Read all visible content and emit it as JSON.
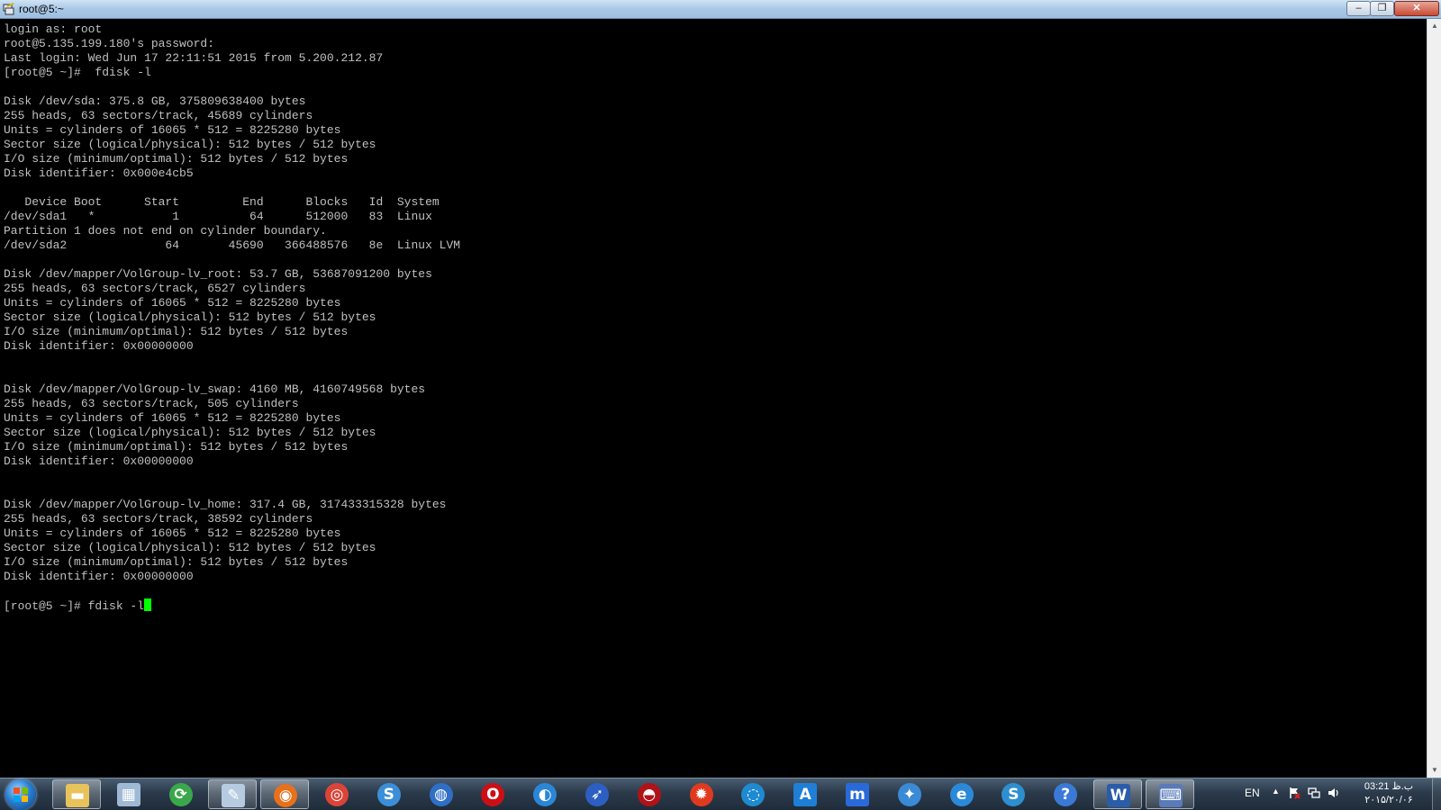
{
  "window": {
    "title": "root@5:~",
    "min_label": "–",
    "max_label": "❐",
    "close_label": "✕"
  },
  "terminal": {
    "lines": [
      "login as: root",
      "root@5.135.199.180's password:",
      "Last login: Wed Jun 17 22:11:51 2015 from 5.200.212.87",
      "[root@5 ~]#  fdisk -l",
      "",
      "Disk /dev/sda: 375.8 GB, 375809638400 bytes",
      "255 heads, 63 sectors/track, 45689 cylinders",
      "Units = cylinders of 16065 * 512 = 8225280 bytes",
      "Sector size (logical/physical): 512 bytes / 512 bytes",
      "I/O size (minimum/optimal): 512 bytes / 512 bytes",
      "Disk identifier: 0x000e4cb5",
      "",
      "   Device Boot      Start         End      Blocks   Id  System",
      "/dev/sda1   *           1          64      512000   83  Linux",
      "Partition 1 does not end on cylinder boundary.",
      "/dev/sda2              64       45690   366488576   8e  Linux LVM",
      "",
      "Disk /dev/mapper/VolGroup-lv_root: 53.7 GB, 53687091200 bytes",
      "255 heads, 63 sectors/track, 6527 cylinders",
      "Units = cylinders of 16065 * 512 = 8225280 bytes",
      "Sector size (logical/physical): 512 bytes / 512 bytes",
      "I/O size (minimum/optimal): 512 bytes / 512 bytes",
      "Disk identifier: 0x00000000",
      "",
      "",
      "Disk /dev/mapper/VolGroup-lv_swap: 4160 MB, 4160749568 bytes",
      "255 heads, 63 sectors/track, 505 cylinders",
      "Units = cylinders of 16065 * 512 = 8225280 bytes",
      "Sector size (logical/physical): 512 bytes / 512 bytes",
      "I/O size (minimum/optimal): 512 bytes / 512 bytes",
      "Disk identifier: 0x00000000",
      "",
      "",
      "Disk /dev/mapper/VolGroup-lv_home: 317.4 GB, 317433315328 bytes",
      "255 heads, 63 sectors/track, 38592 cylinders",
      "Units = cylinders of 16065 * 512 = 8225280 bytes",
      "Sector size (logical/physical): 512 bytes / 512 bytes",
      "I/O size (minimum/optimal): 512 bytes / 512 bytes",
      "Disk identifier: 0x00000000",
      ""
    ],
    "prompt": "[root@5 ~]# fdisk -l",
    "cursor_color": "#00ff00",
    "text_color": "#c0c0c0"
  },
  "taskbar": {
    "apps": [
      {
        "name": "windows-explorer",
        "icon": "folder-icon",
        "color": "#e8c25a",
        "glyph": "▬",
        "shape": "sq",
        "active": true
      },
      {
        "name": "calculator",
        "icon": "calculator-icon",
        "color": "#9fb8d4",
        "glyph": "▦",
        "shape": "sq",
        "active": false
      },
      {
        "name": "network-app",
        "icon": "globe-arrows-icon",
        "color": "#3aa84a",
        "glyph": "⟳",
        "shape": "round",
        "active": false
      },
      {
        "name": "notepad",
        "icon": "notepad-icon",
        "color": "#b7cbe0",
        "glyph": "✎",
        "shape": "sq",
        "active": true
      },
      {
        "name": "firefox",
        "icon": "firefox-icon",
        "color": "#e8701a",
        "glyph": "◉",
        "shape": "round",
        "active": true
      },
      {
        "name": "chrome",
        "icon": "chrome-icon",
        "color": "#db4437",
        "glyph": "◎",
        "shape": "round",
        "active": false
      },
      {
        "name": "swing-browser",
        "icon": "swirl-browser-icon",
        "color": "#3b8fd8",
        "glyph": "S",
        "shape": "round",
        "active": false
      },
      {
        "name": "globe-browser",
        "icon": "blue-globe-icon",
        "color": "#2f6fc6",
        "glyph": "◍",
        "shape": "round",
        "active": false
      },
      {
        "name": "opera",
        "icon": "opera-icon",
        "color": "#cc0f16",
        "glyph": "O",
        "shape": "round",
        "active": false
      },
      {
        "name": "planet-browser",
        "icon": "planet-icon",
        "color": "#2a86d6",
        "glyph": "◐",
        "shape": "round",
        "active": false
      },
      {
        "name": "feather-browser",
        "icon": "feather-icon",
        "color": "#2d5fc2",
        "glyph": "➶",
        "shape": "round",
        "active": false
      },
      {
        "name": "comodo-dragon",
        "icon": "dragon-icon",
        "color": "#b01218",
        "glyph": "◓",
        "shape": "round",
        "active": false
      },
      {
        "name": "flame-browser",
        "icon": "flame-icon",
        "color": "#e03a1e",
        "glyph": "✹",
        "shape": "round",
        "active": false
      },
      {
        "name": "sea-browser",
        "icon": "wave-globe-icon",
        "color": "#1e8ad0",
        "glyph": "◌",
        "shape": "round",
        "active": false
      },
      {
        "name": "avant-browser",
        "icon": "letter-a-icon",
        "color": "#1f7fd6",
        "glyph": "A",
        "shape": "sq",
        "active": false
      },
      {
        "name": "maxthon",
        "icon": "maxthon-icon",
        "color": "#2a6ad8",
        "glyph": "m",
        "shape": "sq",
        "active": false
      },
      {
        "name": "safari",
        "icon": "compass-icon",
        "color": "#3a8ad6",
        "glyph": "✦",
        "shape": "round",
        "active": false
      },
      {
        "name": "internet-explorer",
        "icon": "ie-icon",
        "color": "#2a8ad8",
        "glyph": "e",
        "shape": "round",
        "active": false
      },
      {
        "name": "swirl-app",
        "icon": "yellow-swirl-icon",
        "color": "#2d8fd0",
        "glyph": "S",
        "shape": "round",
        "active": false
      },
      {
        "name": "help-browser",
        "icon": "question-globe-icon",
        "color": "#3a7ad6",
        "glyph": "?",
        "shape": "round",
        "active": false
      },
      {
        "name": "microsoft-word",
        "icon": "word-icon",
        "color": "#2b5ca8",
        "glyph": "W",
        "shape": "sq",
        "active": true
      },
      {
        "name": "putty",
        "icon": "putty-icon",
        "color": "#5a7ab8",
        "glyph": "⌨",
        "shape": "sq",
        "active": true
      }
    ],
    "language": "EN",
    "tray_arrow": "▲",
    "clock_time": "03:21 ب.ظ",
    "clock_date": "۲۰۱۵/۲۰/۰۶"
  }
}
